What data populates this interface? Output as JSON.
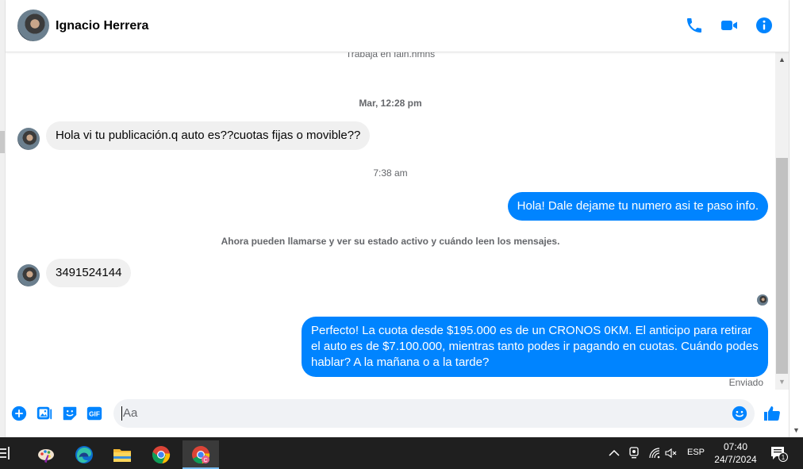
{
  "header": {
    "contact_name": "Ignacio Herrera",
    "icons": [
      "phone-icon",
      "video-icon",
      "info-icon"
    ],
    "accent_color": "#0084ff"
  },
  "chat": {
    "subtitle": "Trabaja en fain.hmns",
    "timestamp_1": "Mar, 12:28 pm",
    "msg_in_1": "Hola vi tu publicación.q auto es??cuotas fijas o movible??",
    "timestamp_2": "7:38 am",
    "msg_out_1": "Hola! Dale dejame tu numero  asi te paso info.",
    "notice": "Ahora pueden llamarse y ver su estado activo y cuándo leen los mensajes.",
    "msg_in_2": "3491524144",
    "msg_out_2": "Perfecto! La cuota desde $195.000 es de un CRONOS 0KM. El anticipo para retirar el auto es de $7.100.000, mientras tanto podes ir pagando en cuotas. Cuándo podes hablar? A la mañana o a la tarde?",
    "status": "Enviado"
  },
  "composer": {
    "placeholder": "Aa",
    "gif_label": "GIF",
    "icons": [
      "plus-icon",
      "image-icon",
      "sticker-icon",
      "gif-icon",
      "emoji-icon",
      "like-icon"
    ]
  },
  "taskbar": {
    "apps": [
      "task-view-icon",
      "paint-icon",
      "edge-icon",
      "file-explorer-icon",
      "chrome-icon",
      "chrome-profile-icon"
    ],
    "lang": "ESP",
    "time": "07:40",
    "date": "24/7/2024",
    "notification_count": "1"
  }
}
